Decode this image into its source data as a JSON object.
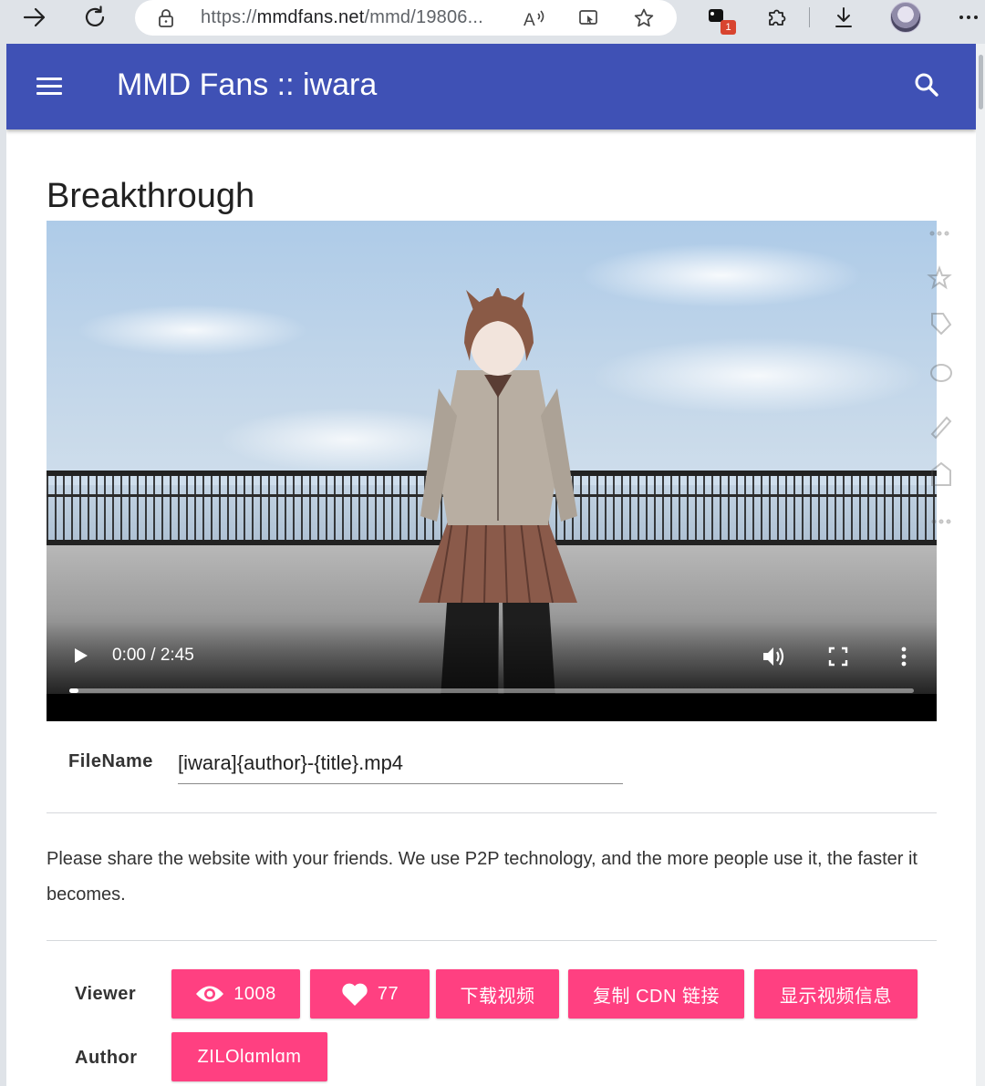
{
  "browser": {
    "url_prefix": "https://",
    "url_domain": "mmdfans.net",
    "url_path": "/mmd/19806...",
    "extension_badge": "1"
  },
  "app": {
    "title": "MMD Fans :: iwara"
  },
  "video": {
    "title": "Breakthrough",
    "time": "0:00 / 2:45",
    "progress_fraction": 0.01
  },
  "filename": {
    "label": "FileName",
    "value": "[iwara]{author}-{title}.mp4"
  },
  "share_text": "Please share the website with your friends. We use P2P technology, and the more people use it, the faster it becomes.",
  "viewer": {
    "label": "Viewer",
    "views": "1008",
    "likes": "77",
    "download_label": "下载视频",
    "copy_cdn_label": "复制 CDN 链接",
    "show_info_label": "显示视频信息"
  },
  "author": {
    "label": "Author",
    "name": "ZILOlɑmlɑm"
  },
  "colors": {
    "appbar": "#3f51b5",
    "accent": "#ff4081"
  }
}
